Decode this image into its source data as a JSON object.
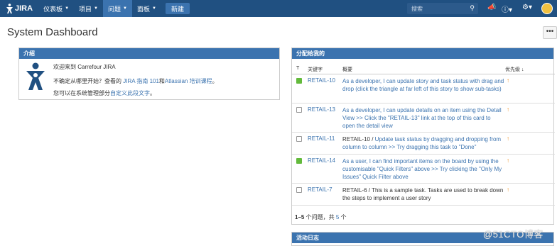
{
  "nav": {
    "logo_text": "JIRA",
    "items": [
      {
        "label": "仪表板"
      },
      {
        "label": "项目"
      },
      {
        "label": "问题"
      },
      {
        "label": "面板"
      }
    ],
    "create_label": "新建",
    "search_placeholder": "搜索"
  },
  "page": {
    "title": "System Dashboard",
    "tools_label": "•••"
  },
  "intro": {
    "header": "介绍",
    "welcome": "欢迎来到 Carrefour JIRA",
    "line2_pre": "不确定从哪里开始？查看的 ",
    "line2_link1": "JIRA 指南 101",
    "line2_mid": "和",
    "line2_link2": "Atlassian 培训课程",
    "line2_post": "。",
    "line3_pre": "您可以在系统管理部分",
    "line3_link": "自定义此段文字",
    "line3_post": "。"
  },
  "assigned": {
    "header": "分配给我的",
    "columns": {
      "type": "T",
      "key": "关键字",
      "summary": "概要",
      "priority": "优先级"
    },
    "sort_indicator": "↓",
    "rows": [
      {
        "type": "story",
        "key": "RETAIL-10",
        "parent": "",
        "summary": "As a developer, I can update story and task status with drag and drop (click the triangle at far left of this story to show sub-tasks)"
      },
      {
        "type": "task",
        "key": "RETAIL-13",
        "parent": "",
        "summary": "As a developer, I can update details on an item using the Detail View >> Click the \"RETAIL-13\" link at the top of this card to open the detail view"
      },
      {
        "type": "task",
        "key": "RETAIL-11",
        "parent": "RETAIL-10 /",
        "summary": "Update task status by dragging and dropping from column to column >> Try dragging this task to \"Done\""
      },
      {
        "type": "story",
        "key": "RETAIL-14",
        "parent": "",
        "summary": "As a user, I can find important items on the board by using the customisable \"Quick Filters\" above >> Try clicking the \"Only My Issues\" Quick Filter above"
      },
      {
        "type": "task",
        "key": "RETAIL-7",
        "parent": "RETAIL-6 /",
        "summary": "This is a sample task. Tasks are used to break down the steps to implement a user story"
      }
    ],
    "count_range": "1–5",
    "count_mid": " 个问题，共 ",
    "count_total": "5",
    "count_post": " 个"
  },
  "activity": {
    "header": "活动日志"
  },
  "watermark": "@51CTO博客",
  "colors": {
    "nav_bg": "#205081",
    "header_bg": "#3b73af",
    "link": "#3b73af",
    "priority": "#f08c1e",
    "story": "#63ba3c"
  }
}
